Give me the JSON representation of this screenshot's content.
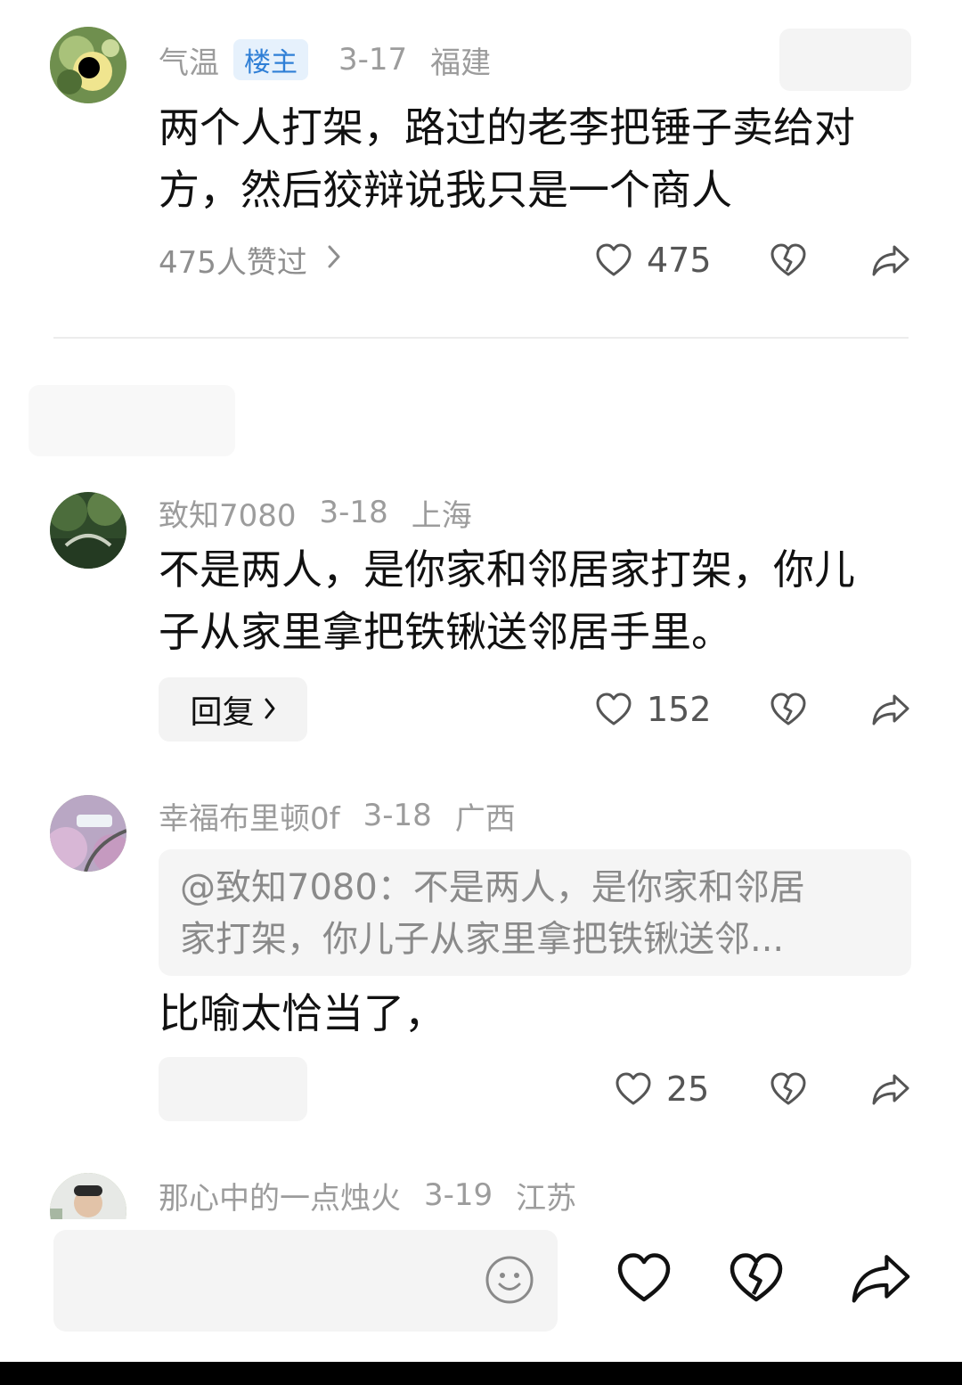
{
  "comments": [
    {
      "username": "气温",
      "badge": "楼主",
      "date": "3-17",
      "location": "福建",
      "text_lines": [
        "两个人打架，路过的老李把锤子卖给对",
        "方，然后狡辩说我只是一个商人"
      ],
      "likes_link": "475人赞过",
      "like_count": "475"
    },
    {
      "username": "致知7080",
      "date": "3-18",
      "location": "上海",
      "text_lines": [
        "不是两人，是你家和邻居家打架，你儿",
        "子从家里拿把铁锹送邻居手里。"
      ],
      "reply_label": "回复",
      "like_count": "152"
    },
    {
      "username": "幸福布里顿0f",
      "date": "3-18",
      "location": "广西",
      "quote_lines": [
        "@致知7080：不是两人，是你家和邻居",
        "家打架，你儿子从家里拿把铁锹送邻..."
      ],
      "text": "比喻太恰当了，",
      "like_count": "25"
    },
    {
      "username": "那心中的一点烛火",
      "date": "3-19",
      "location": "江苏"
    }
  ],
  "icons": {
    "like": "heart-outline-icon",
    "dislike": "broken-heart-icon",
    "share": "share-arrow-icon",
    "emoji": "smiley-icon"
  },
  "colors": {
    "badge_bg": "#e6f1fc",
    "badge_text": "#2f7fd6",
    "meta": "#9c9c9c"
  }
}
